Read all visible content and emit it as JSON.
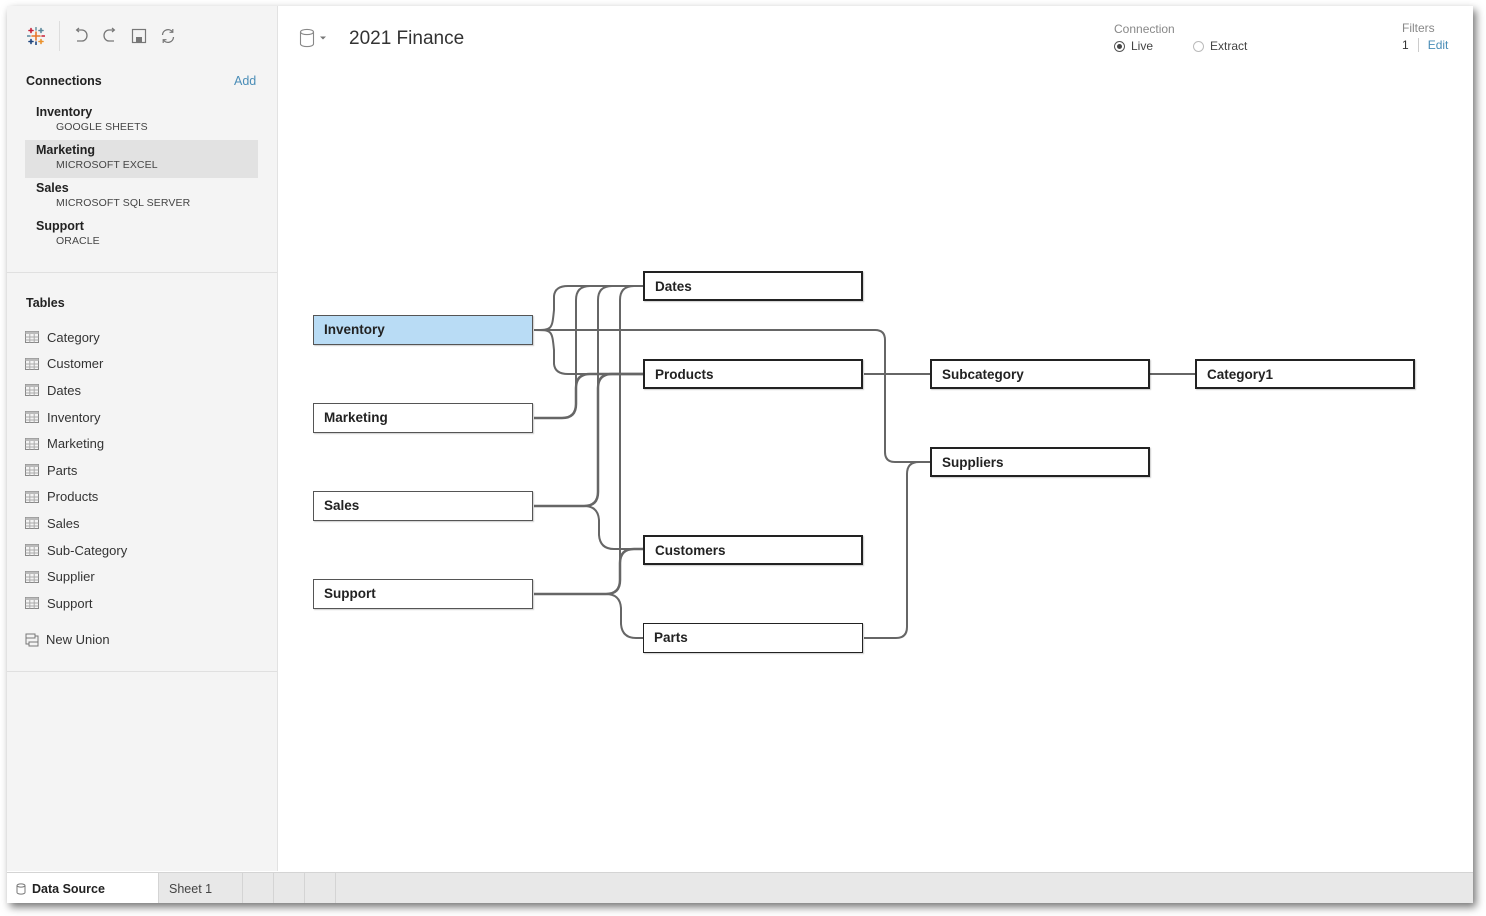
{
  "toolbar": {
    "icons": [
      "tableau-logo-icon",
      "undo-icon",
      "redo-icon",
      "save-icon",
      "refresh-icon"
    ]
  },
  "connections": {
    "heading": "Connections",
    "add_label": "Add",
    "items": [
      {
        "name": "Inventory",
        "type": "GOOGLE SHEETS",
        "selected": false
      },
      {
        "name": "Marketing",
        "type": "MICROSOFT EXCEL",
        "selected": true
      },
      {
        "name": "Sales",
        "type": "MICROSOFT SQL SERVER",
        "selected": false
      },
      {
        "name": "Support",
        "type": "ORACLE",
        "selected": false
      }
    ]
  },
  "tables": {
    "heading": "Tables",
    "items": [
      "Category",
      "Customer",
      "Dates",
      "Inventory",
      "Marketing",
      "Parts",
      "Products",
      "Sales",
      "Sub-Category",
      "Supplier",
      "Support"
    ],
    "new_union_label": "New Union"
  },
  "header": {
    "datasource_title": "2021 Finance",
    "connection_label": "Connection",
    "live_label": "Live",
    "extract_label": "Extract",
    "connection_mode": "Live",
    "filters_label": "Filters",
    "filters_count": "1",
    "filters_edit_label": "Edit"
  },
  "diagram": {
    "nodes": [
      {
        "id": "inventory",
        "label": "Inventory",
        "root": true,
        "selected": true
      },
      {
        "id": "marketing",
        "label": "Marketing",
        "root": true
      },
      {
        "id": "sales",
        "label": "Sales",
        "root": true
      },
      {
        "id": "support",
        "label": "Support",
        "root": true
      },
      {
        "id": "dates",
        "label": "Dates"
      },
      {
        "id": "products",
        "label": "Products"
      },
      {
        "id": "customers",
        "label": "Customers"
      },
      {
        "id": "parts",
        "label": "Parts"
      },
      {
        "id": "subcategory",
        "label": "Subcategory"
      },
      {
        "id": "suppliers",
        "label": "Suppliers"
      },
      {
        "id": "category1",
        "label": "Category1"
      }
    ],
    "links": [
      [
        "inventory",
        "dates"
      ],
      [
        "inventory",
        "products"
      ],
      [
        "inventory",
        "suppliers"
      ],
      [
        "marketing",
        "products"
      ],
      [
        "marketing",
        "dates"
      ],
      [
        "sales",
        "products"
      ],
      [
        "sales",
        "dates"
      ],
      [
        "sales",
        "customers"
      ],
      [
        "support",
        "customers"
      ],
      [
        "support",
        "dates"
      ],
      [
        "support",
        "parts"
      ],
      [
        "products",
        "subcategory"
      ],
      [
        "subcategory",
        "category1"
      ],
      [
        "parts",
        "suppliers"
      ]
    ]
  },
  "bottom_tabs": {
    "data_source_label": "Data Source",
    "sheet_label": "Sheet 1"
  }
}
